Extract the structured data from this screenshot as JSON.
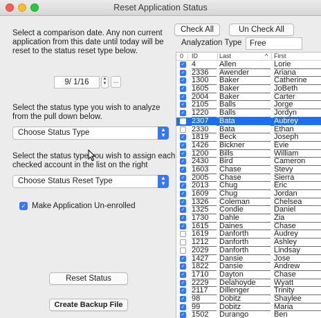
{
  "window": {
    "title": "Reset Application Status"
  },
  "left": {
    "intro": [
      "Select a comparison date. Any non current",
      "application from this date until today will be",
      "reset to the status reset type below."
    ],
    "date_value": "9/ 1/16",
    "stepper_icon": "stepper-arrows",
    "ellipsis": "...",
    "analyze_prompt": [
      "Select the status type you wish to analyze",
      "from the pull down below."
    ],
    "status_type_popup": "Choose Status Type",
    "assign_prompt": [
      "Select the status type you wish to assign each",
      "checked account in the list on the right"
    ],
    "status_reset_popup": "Choose Status Reset Type",
    "unenroll_label": "Make Application Un-enrolled",
    "unenroll_checked": true,
    "reset_button": "Reset Status",
    "backup_button": "Create Backup File"
  },
  "right": {
    "check_all": "Check All",
    "uncheck_all": "Un Check All",
    "analyzation_label": "Analyzation Type",
    "analyzation_value": "Free",
    "columns": {
      "check": "0",
      "id": "ID",
      "last": "Last",
      "sort": "^",
      "first": "First"
    },
    "rows": [
      {
        "checked": true,
        "id": "4",
        "last": "Allen",
        "first": "Lorie"
      },
      {
        "checked": true,
        "id": "2336",
        "last": "Awender",
        "first": "Ariana"
      },
      {
        "checked": true,
        "id": "1300",
        "last": "Baker",
        "first": "Catherine"
      },
      {
        "checked": true,
        "id": "1605",
        "last": "Baker",
        "first": "JoBeth"
      },
      {
        "checked": true,
        "id": "2004",
        "last": "Baker",
        "first": "Carter"
      },
      {
        "checked": true,
        "id": "2105",
        "last": "Balls",
        "first": "Jorge"
      },
      {
        "checked": true,
        "id": "1220",
        "last": "Balls",
        "first": "Jordyn"
      },
      {
        "checked": false,
        "id": "2307",
        "last": "Bata",
        "first": "Aubrey",
        "selected": true
      },
      {
        "checked": false,
        "id": "2330",
        "last": "Bata",
        "first": "Ethan"
      },
      {
        "checked": true,
        "id": "1819",
        "last": "Beck",
        "first": "Joseph"
      },
      {
        "checked": true,
        "id": "1426",
        "last": "Bickner",
        "first": "Evie"
      },
      {
        "checked": true,
        "id": "1200",
        "last": "Bills",
        "first": "William"
      },
      {
        "checked": true,
        "id": "2430",
        "last": "Bird",
        "first": "Cameron"
      },
      {
        "checked": true,
        "id": "1603",
        "last": "Chase",
        "first": "Stevy"
      },
      {
        "checked": true,
        "id": "2005",
        "last": "Chase",
        "first": "Sierra"
      },
      {
        "checked": true,
        "id": "2013",
        "last": "Chug",
        "first": "Eric"
      },
      {
        "checked": true,
        "id": "1609",
        "last": "Chug",
        "first": "Jordan"
      },
      {
        "checked": true,
        "id": "1326",
        "last": "Coleman",
        "first": "Chelsea"
      },
      {
        "checked": true,
        "id": "1325",
        "last": "Condie",
        "first": "Daniel"
      },
      {
        "checked": true,
        "id": "1730",
        "last": "Dahle",
        "first": "Zia"
      },
      {
        "checked": true,
        "id": "1615",
        "last": "Daines",
        "first": "Chase"
      },
      {
        "checked": false,
        "id": "1619",
        "last": "Danforth",
        "first": "Audrey"
      },
      {
        "checked": false,
        "id": "1212",
        "last": "Danforth",
        "first": "Ashley"
      },
      {
        "checked": false,
        "id": "2029",
        "last": "Danforth",
        "first": "Lindsay"
      },
      {
        "checked": true,
        "id": "1427",
        "last": "Dansie",
        "first": "Jose"
      },
      {
        "checked": true,
        "id": "1822",
        "last": "Dansie",
        "first": "Andrew"
      },
      {
        "checked": true,
        "id": "1710",
        "last": "Dayton",
        "first": "Chase"
      },
      {
        "checked": true,
        "id": "2229",
        "last": "Delahoyde",
        "first": "Wyatt"
      },
      {
        "checked": true,
        "id": "2117",
        "last": "Dillenger",
        "first": "Trinity"
      },
      {
        "checked": true,
        "id": "98",
        "last": "Dobitz",
        "first": "Shaylee"
      },
      {
        "checked": true,
        "id": "99",
        "last": "Dobitz",
        "first": "Maria"
      },
      {
        "checked": true,
        "id": "1502",
        "last": "Durango",
        "first": "Ben"
      }
    ]
  },
  "colors": {
    "accent": "#3478f6",
    "selection": "#1f6ef0"
  }
}
